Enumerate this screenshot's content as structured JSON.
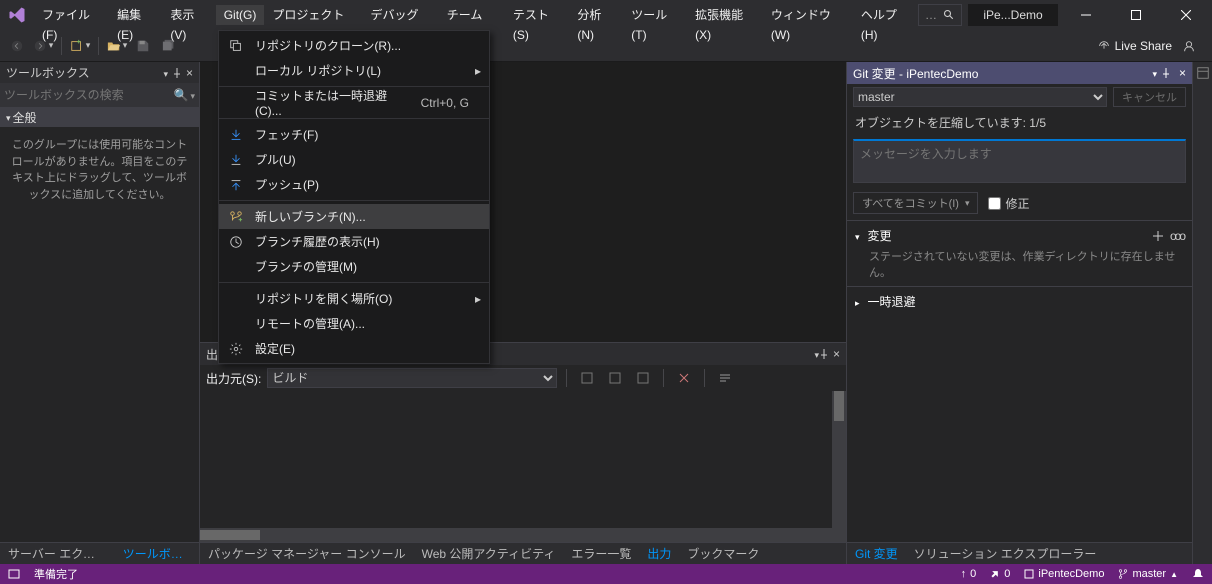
{
  "menu": [
    "ファイル(F)",
    "編集(E)",
    "表示(V)",
    "Git(G)",
    "プロジェクト(P)",
    "デバッグ(D)",
    "チーム(M)",
    "テスト(S)",
    "分析(N)",
    "ツール(T)",
    "拡張機能(X)",
    "ウィンドウ(W)",
    "ヘルプ(H)"
  ],
  "menu_active_index": 3,
  "solution_name": "iPe...Demo",
  "toolbar_right": {
    "live_share": "Live Share"
  },
  "dropdown": {
    "items": [
      {
        "icon": "clone",
        "label": "リポジトリのクローン(R)..."
      },
      {
        "label": "ローカル リポジトリ(L)",
        "submenu": true
      },
      {
        "sep": true
      },
      {
        "label": "コミットまたは一時退避(C)...",
        "shortcut": "Ctrl+0, G"
      },
      {
        "sep": true
      },
      {
        "icon": "fetch",
        "label": "フェッチ(F)"
      },
      {
        "icon": "pull",
        "label": "プル(U)"
      },
      {
        "icon": "push",
        "label": "プッシュ(P)"
      },
      {
        "sep": true
      },
      {
        "icon": "branch-new",
        "label": "新しいブランチ(N)...",
        "hover": true
      },
      {
        "icon": "history",
        "label": "ブランチ履歴の表示(H)"
      },
      {
        "label": "ブランチの管理(M)"
      },
      {
        "sep": true
      },
      {
        "label": "リポジトリを開く場所(O)",
        "submenu": true
      },
      {
        "label": "リモートの管理(A)..."
      },
      {
        "icon": "gear",
        "label": "設定(E)"
      }
    ]
  },
  "toolbox": {
    "title": "ツールボックス",
    "search_placeholder": "ツールボックスの検索",
    "section": "全般",
    "empty": "このグループには使用可能なコントロールがありません。項目をこのテキスト上にドラッグして、ツールボックスに追加してください。"
  },
  "left_tabs": [
    "サーバー エクスプロ...",
    "ツールボックス"
  ],
  "output": {
    "title": "出力",
    "source_label": "出力元(S):",
    "source_value": "ビルド"
  },
  "center_tabs": [
    "パッケージ マネージャー コンソール",
    "Web 公開アクティビティ",
    "エラー一覧",
    "出力",
    "ブックマーク"
  ],
  "git": {
    "title": "Git 変更 - iPentecDemo",
    "branch": "master",
    "cancel": "キャンセル",
    "status": "オブジェクトを圧縮しています: 1/5",
    "msg_placeholder": "メッセージを入力します",
    "commit_all": "すべてをコミット(I)",
    "amend": "修正",
    "changes": "変更",
    "changes_msg": "ステージされていない変更は、作業ディレクトリに存在しません。",
    "stash": "一時退避"
  },
  "right_tabs": [
    "Git 変更",
    "ソリューション エクスプローラー"
  ],
  "status": {
    "ready": "準備完了",
    "up": "0",
    "down": "0",
    "repo": "iPentecDemo",
    "branch": "master"
  }
}
